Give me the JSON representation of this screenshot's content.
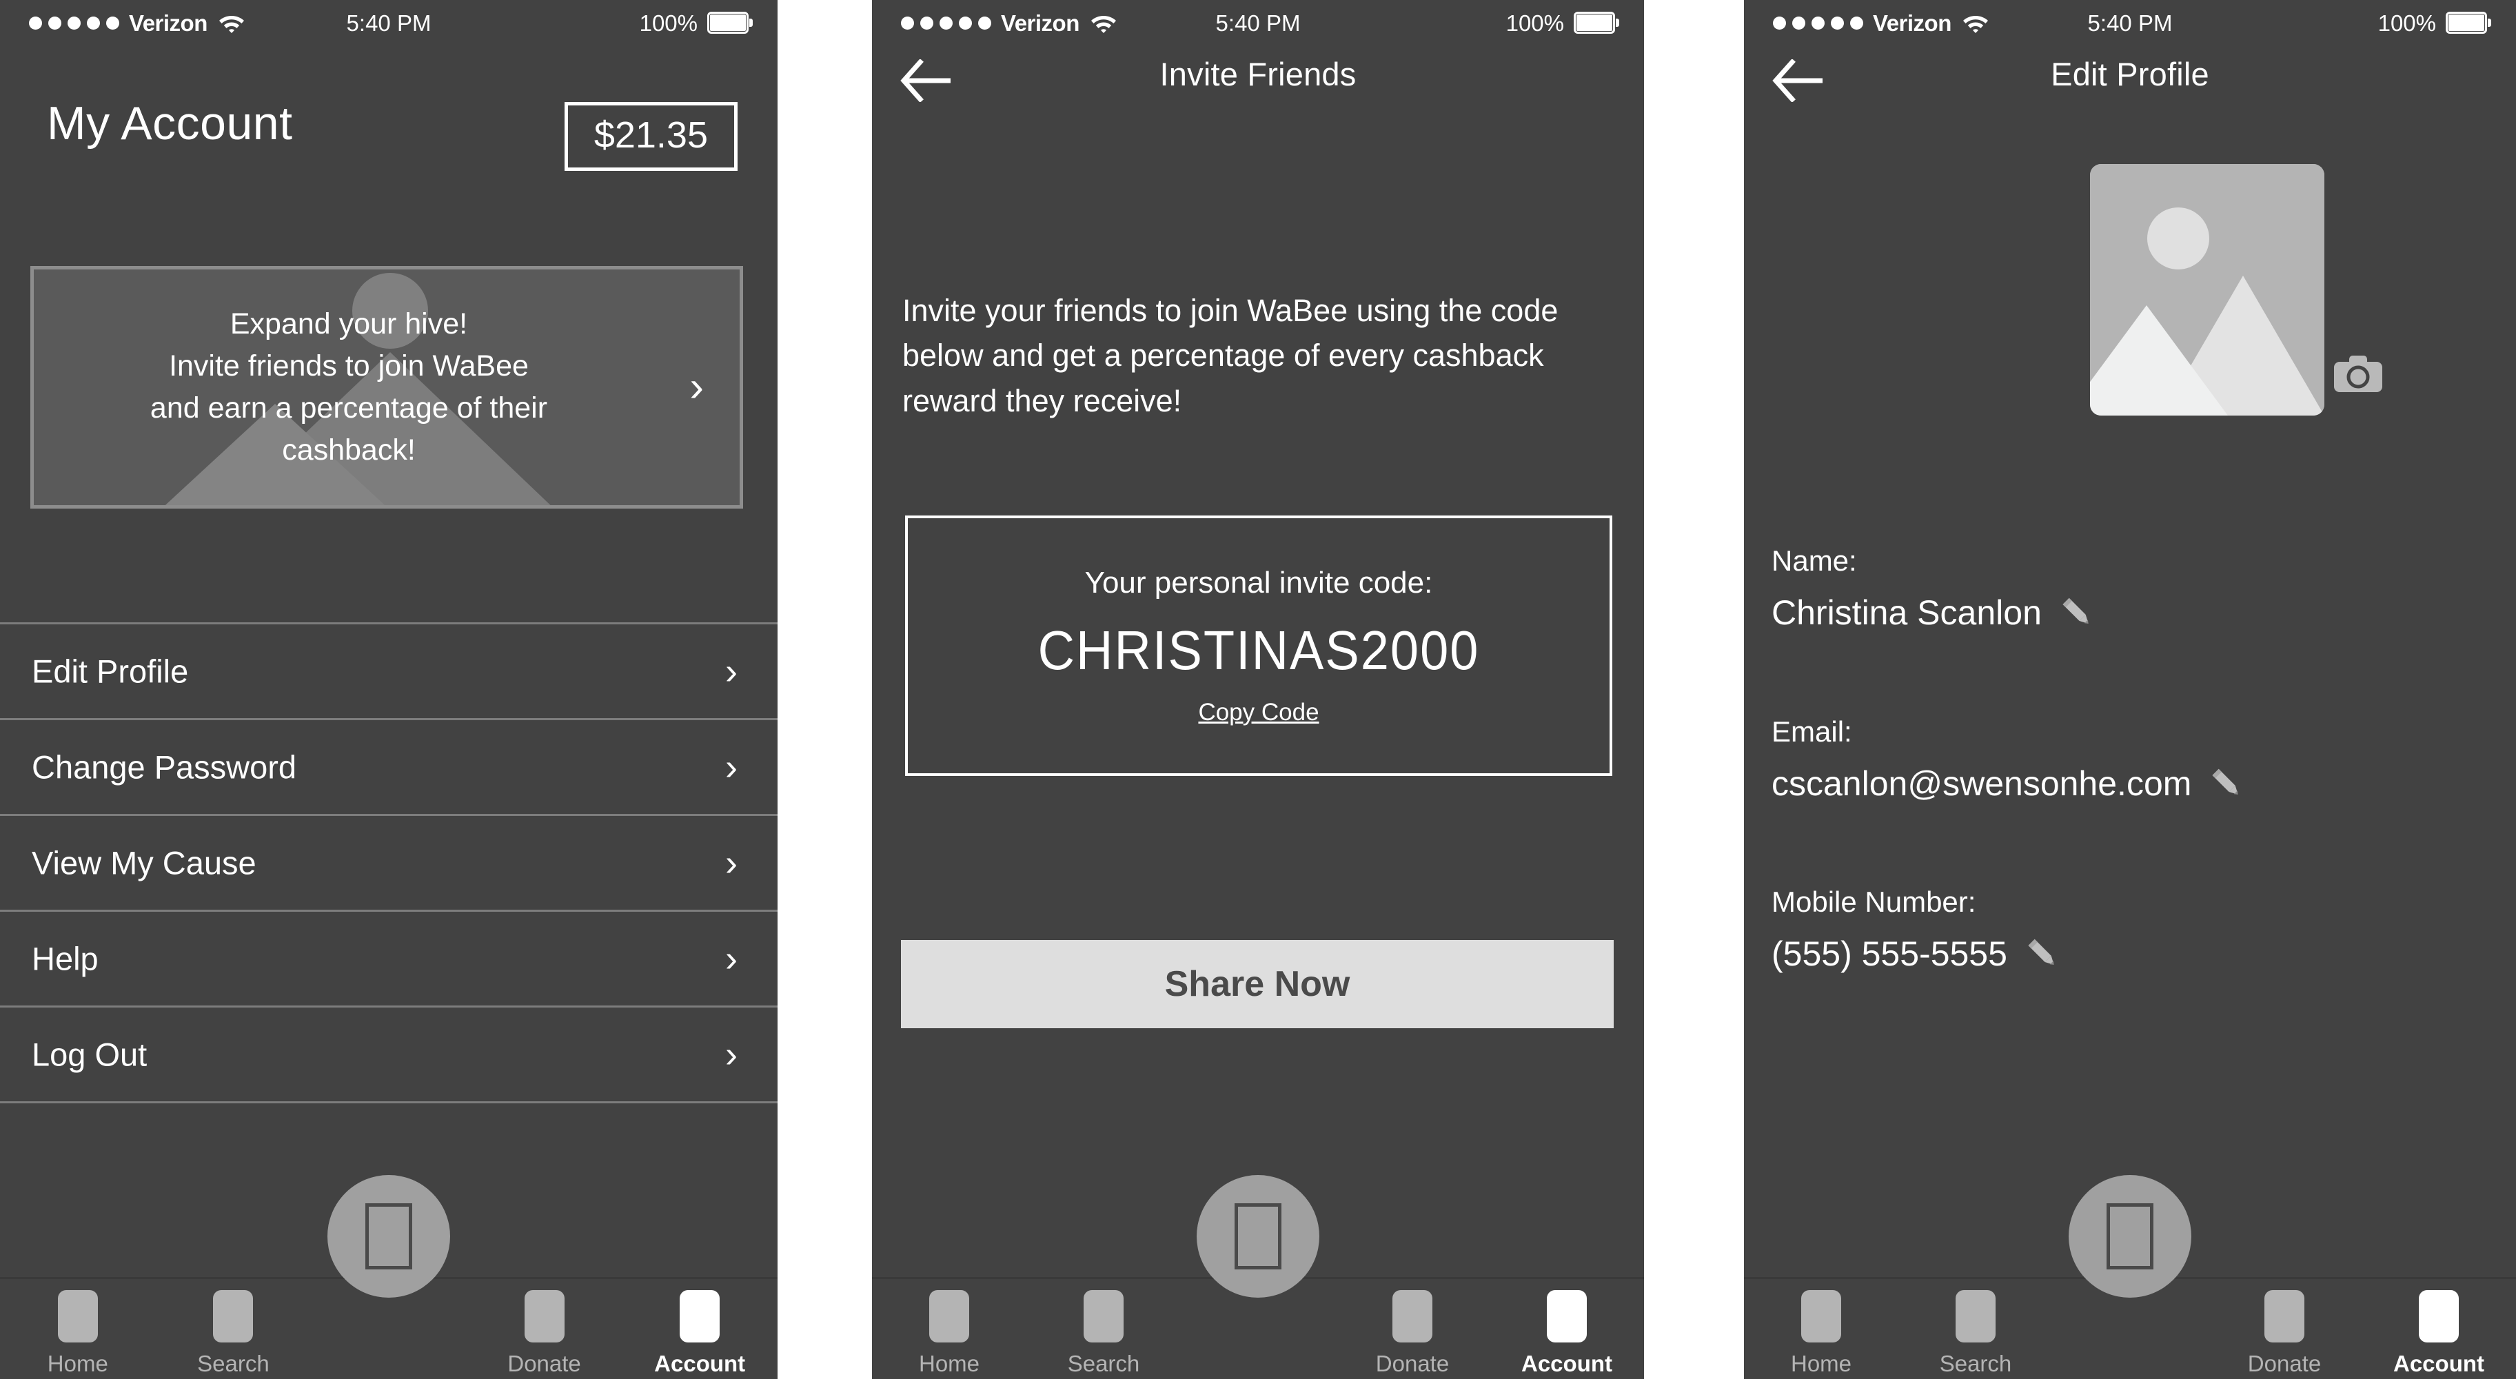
{
  "status_bar": {
    "carrier": "Verizon",
    "signal_dots": 5,
    "wifi_icon": "wifi-icon",
    "time": "5:40 PM",
    "battery_percent": "100%",
    "battery_icon": "battery-full-icon"
  },
  "colors": {
    "screen_background": "#424242",
    "card_background": "#5a5a5a",
    "divider": "#7d7d7d",
    "primary_text": "#ffffff",
    "muted_icon": "#b4b4b4",
    "button_background": "#dedede",
    "button_text": "#4a4a4a",
    "fab_background": "#a0a0a0"
  },
  "account_screen": {
    "title": "My Account",
    "balance": "$21.35",
    "promo_card": {
      "text": "Expand your hive!\nInvite friends to join WaBee\nand earn a percentage of their\ncashback!",
      "chevron": "›",
      "art": "image-placeholder-mountains-icon"
    },
    "menu_items": [
      {
        "label": "Edit Profile",
        "chevron": "›"
      },
      {
        "label": "Change Password",
        "chevron": "›"
      },
      {
        "label": "View My Cause",
        "chevron": "›"
      },
      {
        "label": "Help",
        "chevron": "›"
      },
      {
        "label": "Log Out",
        "chevron": "›"
      }
    ]
  },
  "invite_screen": {
    "nav_title": "Invite Friends",
    "back_icon": "arrow-left-icon",
    "paragraph": "Invite your friends to join WaBee using the code below and get a percentage of every cashback reward they receive!",
    "code_caption": "Your personal invite code:",
    "invite_code": "CHRISTINAS2000",
    "copy_code_label": "Copy Code",
    "share_button_label": "Share Now"
  },
  "profile_screen": {
    "nav_title": "Edit Profile",
    "back_icon": "arrow-left-icon",
    "avatar_icon": "image-placeholder-icon",
    "camera_icon": "camera-icon",
    "fields": [
      {
        "label": "Name:",
        "value": "Christina Scanlon",
        "edit_icon": "pencil-icon"
      },
      {
        "label": "Email:",
        "value": "cscanlon@swensonhe.com",
        "edit_icon": "pencil-icon"
      },
      {
        "label": "Mobile Number:",
        "value": "(555) 555-5555",
        "edit_icon": "pencil-icon"
      }
    ]
  },
  "tab_bar": {
    "center_action_icon": "scan-icon",
    "tabs": [
      {
        "label": "Home",
        "icon": "home-icon",
        "active": false
      },
      {
        "label": "Search",
        "icon": "search-icon",
        "active": false
      },
      {
        "label": "Donate",
        "icon": "donate-icon",
        "active": false
      },
      {
        "label": "Account",
        "icon": "account-icon",
        "active": true
      }
    ]
  }
}
